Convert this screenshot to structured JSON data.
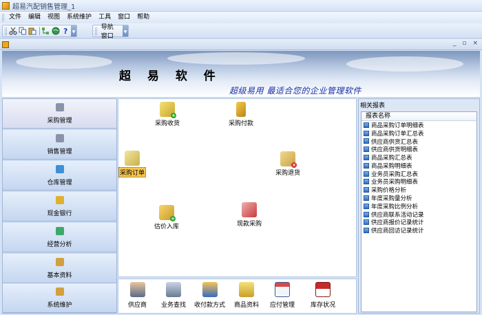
{
  "window": {
    "title": "超易汽配销售管理_1"
  },
  "menubar": {
    "items": [
      "文件",
      "编辑",
      "视图",
      "系统维护",
      "工具",
      "窗口",
      "帮助"
    ]
  },
  "toolbar": {
    "icons": [
      "cut-icon",
      "copy-icon",
      "paste-icon",
      "tree-icon",
      "globe-icon",
      "help-icon"
    ],
    "nav_window_label": "导航窗口"
  },
  "mdi": {
    "controls": [
      "_",
      "▫",
      "×"
    ]
  },
  "banner": {
    "brand": "超 易 软 件",
    "slogan": "超级易用 最适合您的企业管理软件"
  },
  "leftnav": {
    "items": [
      {
        "label": "采购管理",
        "icon": "purchase-icon",
        "color": "#8a93a8"
      },
      {
        "label": "销售管理",
        "icon": "sales-icon",
        "color": "#8a93a8"
      },
      {
        "label": "仓库管理",
        "icon": "warehouse-icon",
        "color": "#3f8fd8"
      },
      {
        "label": "现金银行",
        "icon": "cash-bank-icon",
        "color": "#e0b030"
      },
      {
        "label": "经营分析",
        "icon": "analysis-icon",
        "color": "#3da86a"
      },
      {
        "label": "基本资料",
        "icon": "basic-data-icon",
        "color": "#d2a040"
      },
      {
        "label": "系统维护",
        "icon": "system-icon",
        "color": "#d2a040"
      }
    ]
  },
  "flow": {
    "receive": "采购收货",
    "payment": "采购付款",
    "order": "采购订单",
    "return": "采购退货",
    "estimate": "估价入库",
    "cash_purchase": "现款采购"
  },
  "bottom_tools": [
    "供应商",
    "业务查找",
    "收付款方式",
    "商品资料",
    "应付管理",
    "库存状况"
  ],
  "right_panel": {
    "title": "相关报表",
    "column_header": "报表名称",
    "reports": [
      "商品采购订单明细表",
      "商品采购订单汇总表",
      "供应商供货汇总表",
      "供应商供货明细表",
      "商品采购汇总表",
      "商品采购明细表",
      "业务员采购汇总表",
      "业务员采购明细表",
      "采购价格分析",
      "年度采购量分析",
      "年度采购比例分析",
      "供应商联系活动记录",
      "供应商报价记录统计",
      "供应商回访记录统计"
    ]
  }
}
